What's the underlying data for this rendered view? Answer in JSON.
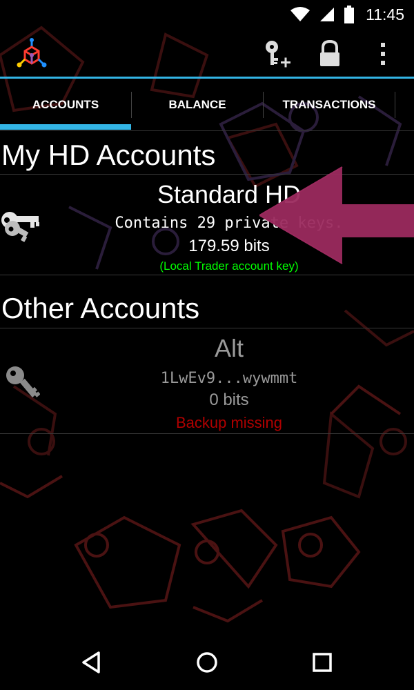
{
  "status_bar": {
    "time": "11:45",
    "icons": [
      "wifi-icon",
      "cell-signal-icon",
      "battery-icon"
    ]
  },
  "action_bar": {
    "logo_icon": "mycelium-logo-icon",
    "actions": [
      "add-key-icon",
      "lock-icon",
      "overflow-menu-icon"
    ]
  },
  "tabs": [
    {
      "label": "ACCOUNTS",
      "selected": true
    },
    {
      "label": "BALANCE",
      "selected": false
    },
    {
      "label": "TRANSACTIONS",
      "selected": false
    }
  ],
  "sections": {
    "hd": {
      "title": "My HD Accounts",
      "account": {
        "name": "Standard HD",
        "subtitle": "Contains 29 private keys.",
        "balance": "179.59 bits",
        "note": "(Local Trader account key)",
        "note_color": "#00ff00",
        "icon": "multiple-keys-icon"
      }
    },
    "other": {
      "title": "Other Accounts",
      "account": {
        "name": "Alt",
        "subtitle": "1LwEv9...wywmmt",
        "balance": "0 bits",
        "note": "Backup missing",
        "note_color": "#b00000",
        "icon": "single-key-icon"
      }
    }
  },
  "annotation_arrow_color": "#9b2a5e",
  "accent_color": "#33b5e5",
  "nav_bar": [
    "back-icon",
    "home-icon",
    "recents-icon"
  ]
}
